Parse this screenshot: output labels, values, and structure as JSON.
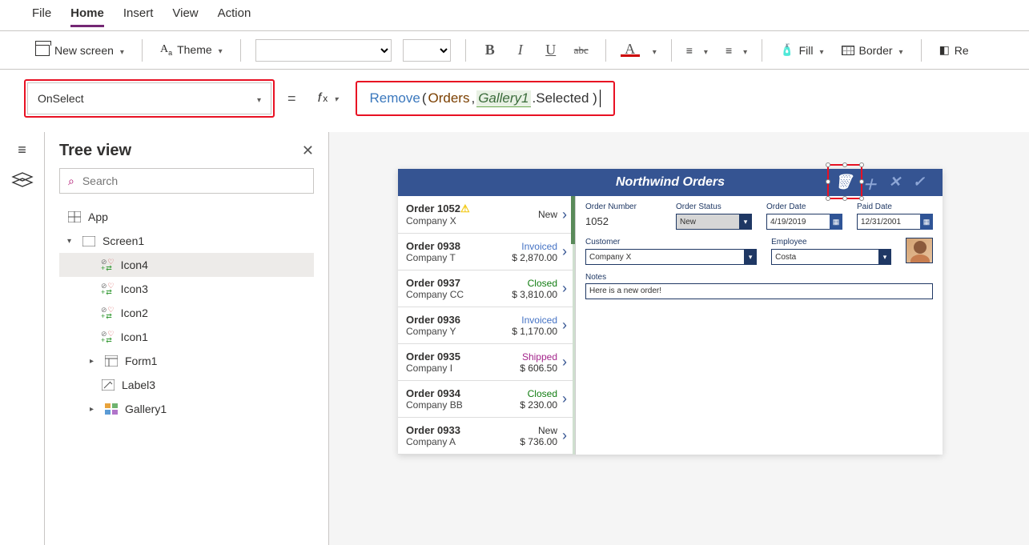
{
  "menu": {
    "items": [
      "File",
      "Home",
      "Insert",
      "View",
      "Action"
    ],
    "active": 1
  },
  "ribbon": {
    "new_screen": "New screen",
    "theme": "Theme",
    "fill": "Fill",
    "border": "Border",
    "reorder": "Re"
  },
  "property": {
    "name": "OnSelect"
  },
  "formula": {
    "fn": "Remove",
    "open": "( ",
    "datasource": "Orders",
    "comma": ", ",
    "gallery": "Gallery1",
    "suffix": ".Selected )"
  },
  "tree": {
    "title": "Tree view",
    "search_placeholder": "Search",
    "nodes": [
      {
        "label": "App",
        "type": "app"
      },
      {
        "label": "Screen1",
        "type": "screen",
        "expanded": true,
        "children": [
          {
            "label": "Icon4",
            "type": "icon",
            "selected": true
          },
          {
            "label": "Icon3",
            "type": "icon"
          },
          {
            "label": "Icon2",
            "type": "icon"
          },
          {
            "label": "Icon1",
            "type": "icon"
          },
          {
            "label": "Form1",
            "type": "form",
            "expandable": true
          },
          {
            "label": "Label3",
            "type": "label"
          },
          {
            "label": "Gallery1",
            "type": "gallery",
            "expandable": true
          }
        ]
      }
    ]
  },
  "app": {
    "title": "Northwind Orders",
    "gallery": [
      {
        "order": "Order 1052",
        "company": "Company X",
        "status": "New",
        "status_class": "st-new",
        "amount": "",
        "warn": true
      },
      {
        "order": "Order 0938",
        "company": "Company T",
        "status": "Invoiced",
        "status_class": "st-invoiced",
        "amount": "$ 2,870.00"
      },
      {
        "order": "Order 0937",
        "company": "Company CC",
        "status": "Closed",
        "status_class": "st-closed",
        "amount": "$ 3,810.00"
      },
      {
        "order": "Order 0936",
        "company": "Company Y",
        "status": "Invoiced",
        "status_class": "st-invoiced",
        "amount": "$ 1,170.00"
      },
      {
        "order": "Order 0935",
        "company": "Company I",
        "status": "Shipped",
        "status_class": "st-shipped",
        "amount": "$ 606.50"
      },
      {
        "order": "Order 0934",
        "company": "Company BB",
        "status": "Closed",
        "status_class": "st-closed",
        "amount": "$ 230.00"
      },
      {
        "order": "Order 0933",
        "company": "Company A",
        "status": "New",
        "status_class": "st-new",
        "amount": "$ 736.00"
      }
    ],
    "detail": {
      "order_number_label": "Order Number",
      "order_number": "1052",
      "order_status_label": "Order Status",
      "order_status": "New",
      "order_date_label": "Order Date",
      "order_date": "4/19/2019",
      "paid_date_label": "Paid Date",
      "paid_date": "12/31/2001",
      "customer_label": "Customer",
      "customer": "Company X",
      "employee_label": "Employee",
      "employee": "Costa",
      "notes_label": "Notes",
      "notes": "Here is a new order!"
    }
  }
}
